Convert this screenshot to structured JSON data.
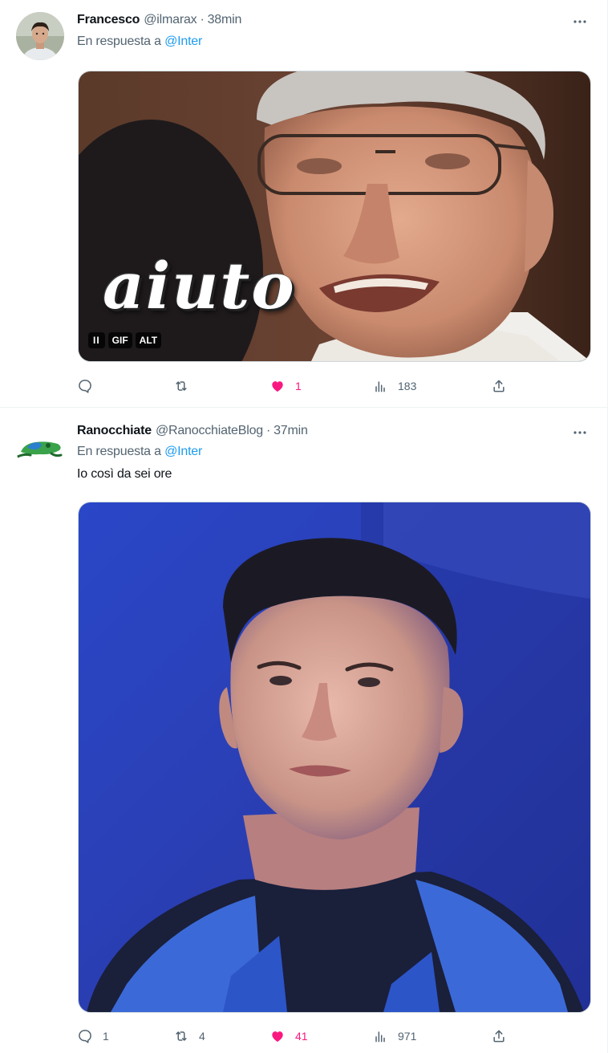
{
  "tweets": [
    {
      "display_name": "Francesco",
      "handle": "@ilmarax",
      "separator": "·",
      "time": "38min",
      "reply_prefix": "En respuesta a",
      "reply_mention": "@Inter",
      "text": "",
      "media": {
        "type": "gif",
        "caption": "aiuto",
        "badges": [
          "II",
          "GIF",
          "ALT"
        ]
      },
      "stats": {
        "replies": "",
        "retweets": "",
        "likes": "1",
        "views": "183"
      },
      "liked": true
    },
    {
      "display_name": "Ranocchiate",
      "handle": "@RanocchiateBlog",
      "separator": "·",
      "time": "37min",
      "reply_prefix": "En respuesta a",
      "reply_mention": "@Inter",
      "text": "Io così da sei ore",
      "media": {
        "type": "photo"
      },
      "stats": {
        "replies": "1",
        "retweets": "4",
        "likes": "41",
        "views": "971"
      },
      "liked": true
    }
  ],
  "icons": {
    "more": "more-horizontal-icon",
    "reply": "reply-bubble-icon",
    "retweet": "retweet-arrows-icon",
    "like": "heart-icon",
    "views": "views-bar-chart-icon",
    "share": "share-upload-icon"
  },
  "colors": {
    "text_primary": "#0f1419",
    "text_secondary": "#536471",
    "link": "#1d9bf0",
    "like": "#f91880",
    "border": "#cfd9de"
  }
}
